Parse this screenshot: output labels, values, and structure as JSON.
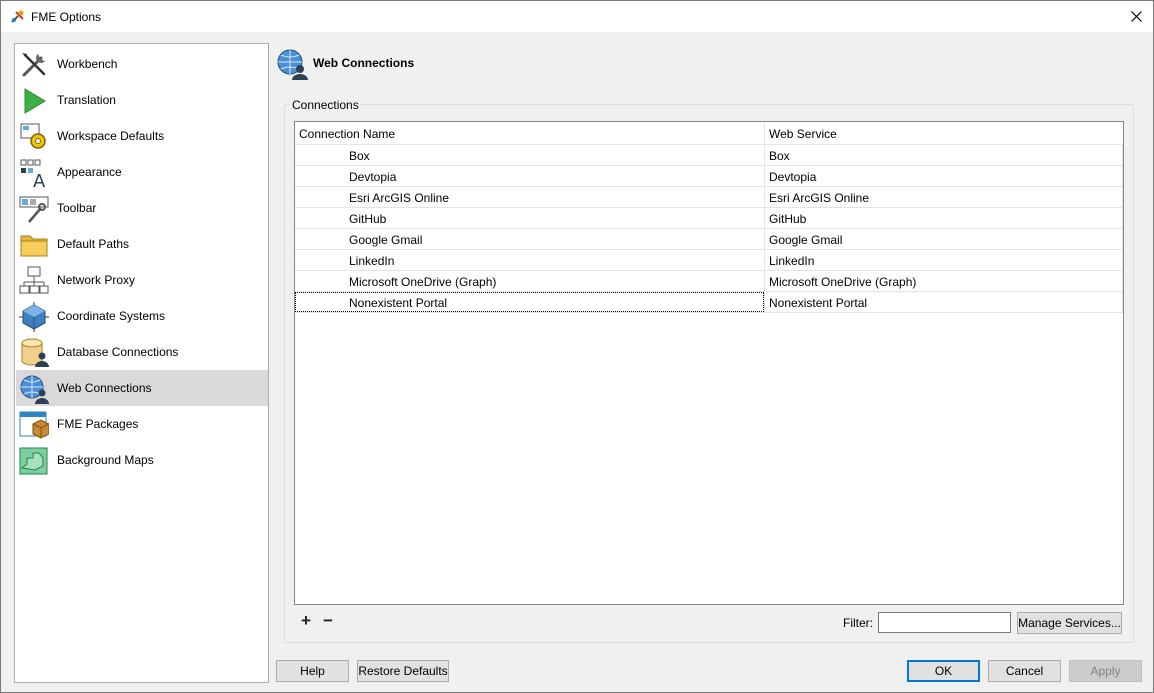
{
  "window": {
    "title": "FME Options"
  },
  "sidebar": {
    "items": [
      {
        "label": "Workbench",
        "icon": "tools-icon"
      },
      {
        "label": "Translation",
        "icon": "play-icon"
      },
      {
        "label": "Workspace Defaults",
        "icon": "workspace-gear-icon"
      },
      {
        "label": "Appearance",
        "icon": "appearance-icon"
      },
      {
        "label": "Toolbar",
        "icon": "toolbar-icon"
      },
      {
        "label": "Default Paths",
        "icon": "folder-icon"
      },
      {
        "label": "Network Proxy",
        "icon": "network-icon"
      },
      {
        "label": "Coordinate Systems",
        "icon": "coordinate-cube-icon"
      },
      {
        "label": "Database Connections",
        "icon": "database-user-icon"
      },
      {
        "label": "Web Connections",
        "icon": "globe-user-icon",
        "selected": true
      },
      {
        "label": "FME Packages",
        "icon": "package-icon"
      },
      {
        "label": "Background Maps",
        "icon": "map-icon"
      }
    ]
  },
  "panel": {
    "title": "Web Connections",
    "group_label": "Connections",
    "table": {
      "columns": [
        "Connection Name",
        "Web Service"
      ],
      "rows": [
        [
          "Box",
          "Box"
        ],
        [
          "Devtopia",
          "Devtopia"
        ],
        [
          "Esri ArcGIS Online",
          "Esri ArcGIS Online"
        ],
        [
          "GitHub",
          "GitHub"
        ],
        [
          "Google Gmail",
          "Google Gmail"
        ],
        [
          "LinkedIn",
          "LinkedIn"
        ],
        [
          "Microsoft OneDrive (Graph)",
          "Microsoft OneDrive (Graph)"
        ],
        [
          "Nonexistent Portal",
          "Nonexistent Portal"
        ]
      ]
    },
    "add_symbol": "+",
    "remove_symbol": "−",
    "filter_label": "Filter:",
    "filter_value": "",
    "manage_services_label": "Manage Services..."
  },
  "footer": {
    "help_label": "Help",
    "restore_label": "Restore Defaults",
    "ok_label": "OK",
    "cancel_label": "Cancel",
    "apply_label": "Apply"
  },
  "colors": {
    "selected_bg": "#d9d9d9",
    "accent": "#0078d7"
  }
}
